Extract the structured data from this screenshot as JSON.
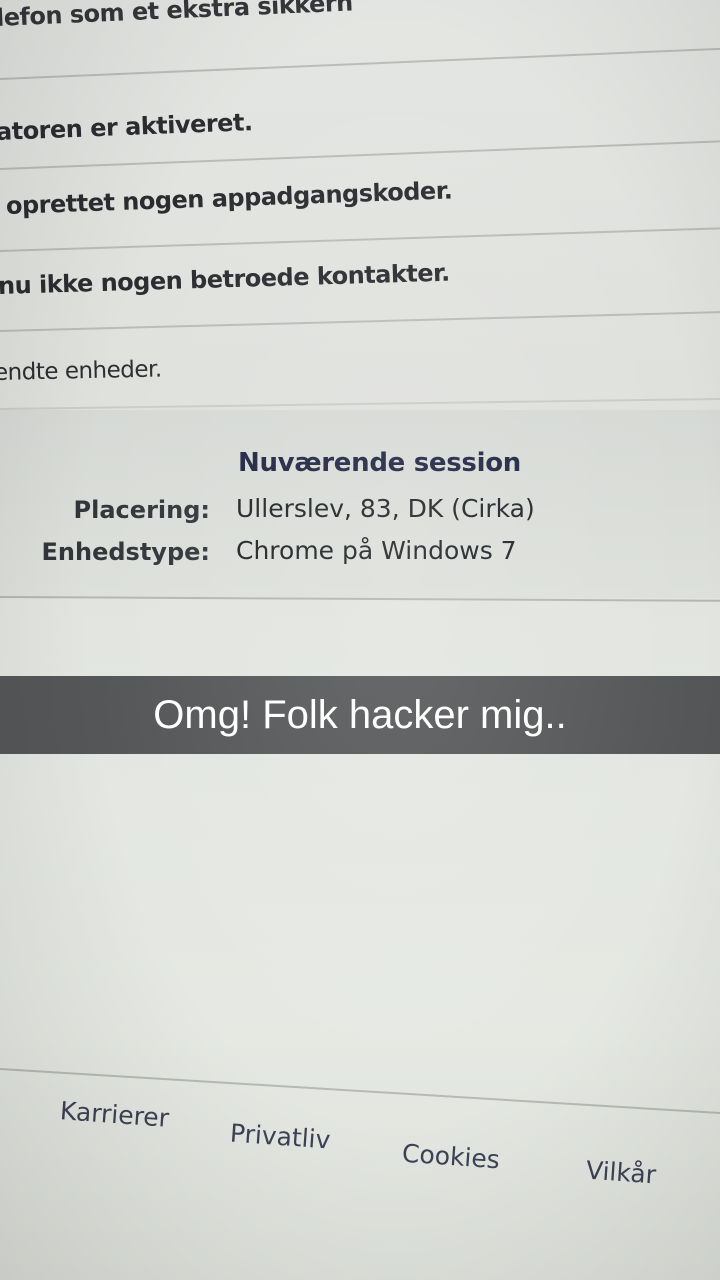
{
  "settings_rows": [
    "lefon som et ekstra sikkerh",
    "atoren er aktiveret.",
    "oprettet nogen appadgangskoder.",
    "nu ikke nogen betroede kontakter.",
    "endte enheder."
  ],
  "session": {
    "heading": "Nuværende session",
    "location_label": "Placering:",
    "location_value": "Ullerslev, 83, DK (Cirka)",
    "device_label": "Enhedstype:",
    "device_value": "Chrome på Windows 7"
  },
  "caption": "Omg! Folk hacker mig..",
  "footer_links": [
    "Karrierer",
    "Privatliv",
    "Cookies",
    "Vilkår"
  ]
}
